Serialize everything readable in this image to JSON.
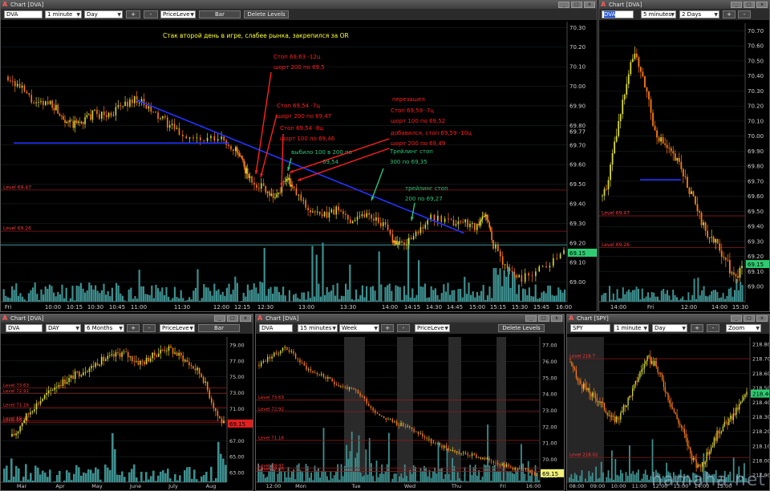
{
  "colors": {
    "red_line": "#8b1a1a",
    "teal_line": "#3a9a9a",
    "blue_trend": "#2233ff",
    "annotation_red": "#ff2020",
    "annotation_green": "#2ec47a",
    "annotation_yellow": "#ffff33",
    "candle_up": "#d8d838",
    "candle_down": "#ff7a1a",
    "volume": "#3e8f8f",
    "price_tag_green": "#2ecc71"
  },
  "watermark": "hamaha.net",
  "windows": {
    "main": {
      "title": "Chart [DVA]",
      "symbol": "DVA",
      "interval": "1 minute",
      "period": "Day",
      "indicator": "PriceLeve",
      "type_button": "Bar",
      "delete_button": "Delete Levels",
      "price_tag": "69.15",
      "last_tag": "69.77"
    },
    "topright": {
      "title": "Chart [DVA]",
      "symbol": "DVA",
      "interval": "5 minutes",
      "period": "2 Days",
      "price_tag": "69.15"
    },
    "bl": {
      "title": "Chart [DVA]",
      "symbol": "DVA",
      "interval": "DAY",
      "period": "6 Months",
      "indicator": "PriceLeve",
      "type_button": "Bar",
      "price_tag": "69.15"
    },
    "bm": {
      "title": "Chart [DVA]",
      "symbol": "DVA",
      "interval": "15 minutes",
      "period": "Week",
      "indicator": "PriceLeve",
      "delete_button": "Delete Levels",
      "price_tag": "69.15"
    },
    "br": {
      "title": "Chart [SPY]",
      "symbol": "SPY",
      "interval": "1 minute",
      "period": "Day",
      "indicator": "Zoom",
      "price_tag": "218.46"
    }
  },
  "chart_data": [
    {
      "id": "main",
      "type": "candlestick",
      "symbol": "DVA",
      "interval": "1 minute",
      "y_ticks": [
        "70.30",
        "70.20",
        "70.10",
        "70.00",
        "69.90",
        "69.80",
        "69.70",
        "69.60",
        "69.50",
        "69.40",
        "69.30",
        "69.20",
        "69.10",
        "69.00"
      ],
      "x_ticks": [
        "Fri",
        "10:00",
        "10:15",
        "10:30",
        "10:45",
        "11:00",
        "11:30",
        "12:00",
        "12:15",
        "12:30",
        "13:00",
        "13:30",
        "14:00",
        "14:15",
        "14:30",
        "14:45",
        "15:00",
        "15:15",
        "15:30",
        "15:45",
        "16:00"
      ],
      "ylim": [
        68.9,
        70.33
      ],
      "time_range": [
        "09:30",
        "16:00"
      ],
      "series": [
        {
          "name": "price",
          "points": [
            [
              "09:30",
              70.05
            ],
            [
              "09:40",
              69.98
            ],
            [
              "09:50",
              69.9
            ],
            [
              "10:00",
              69.92
            ],
            [
              "10:08",
              69.85
            ],
            [
              "10:15",
              69.8
            ],
            [
              "10:22",
              69.82
            ],
            [
              "10:30",
              69.86
            ],
            [
              "10:40",
              69.85
            ],
            [
              "10:50",
              69.9
            ],
            [
              "11:00",
              69.94
            ],
            [
              "11:10",
              69.87
            ],
            [
              "11:20",
              69.82
            ],
            [
              "11:30",
              69.76
            ],
            [
              "11:45",
              69.72
            ],
            [
              "12:00",
              69.73
            ],
            [
              "12:10",
              69.67
            ],
            [
              "12:15",
              69.6
            ],
            [
              "12:20",
              69.52
            ],
            [
              "12:30",
              69.48
            ],
            [
              "12:38",
              69.43
            ],
            [
              "12:45",
              69.54
            ],
            [
              "12:50",
              69.47
            ],
            [
              "13:00",
              69.38
            ],
            [
              "13:10",
              69.33
            ],
            [
              "13:20",
              69.37
            ],
            [
              "13:30",
              69.32
            ],
            [
              "13:40",
              69.35
            ],
            [
              "13:50",
              69.32
            ],
            [
              "14:00",
              69.22
            ],
            [
              "14:05",
              69.19
            ],
            [
              "14:15",
              69.23
            ],
            [
              "14:25",
              69.33
            ],
            [
              "14:40",
              69.3
            ],
            [
              "14:50",
              69.31
            ],
            [
              "15:00",
              69.28
            ],
            [
              "15:05",
              69.36
            ],
            [
              "15:10",
              69.2
            ],
            [
              "15:20",
              69.07
            ],
            [
              "15:30",
              69.02
            ],
            [
              "15:45",
              69.08
            ],
            [
              "16:00",
              69.15
            ]
          ]
        }
      ],
      "levels": [
        {
          "label": "Level 69.47",
          "value": 69.47,
          "color": "red"
        },
        {
          "label": "Level 69.26",
          "value": 69.26,
          "color": "red"
        },
        {
          "label": "",
          "value": 69.19,
          "color": "teal"
        }
      ],
      "trendlines": [
        {
          "from": [
            "09:34",
            69.71
          ],
          "to": [
            "12:05",
            69.71
          ]
        },
        {
          "from": [
            "11:00",
            69.93
          ],
          "to": [
            "14:50",
            69.25
          ]
        }
      ],
      "annotations": [
        {
          "text": "Стак второй день в игре, слабее рынка, закрепился за OR",
          "color": "yellow"
        },
        {
          "text": "Стоп 69,63 -12ц",
          "color": "red"
        },
        {
          "text": "шорт 200 по 69,5",
          "color": "red"
        },
        {
          "text": "Стоп 69,54 -7ц",
          "color": "red"
        },
        {
          "text": "шорт 200 по 69,47",
          "color": "red"
        },
        {
          "text": "Стоп 69,54 -8ц",
          "color": "red"
        },
        {
          "text": "шорт 100 по 69,46",
          "color": "red"
        },
        {
          "text": "выбило 100 в 200 по",
          "color": "green"
        },
        {
          "text": "69,54",
          "color": "green"
        },
        {
          "text": "перезашел",
          "color": "red"
        },
        {
          "text": "Стоп 69,59 -7ц",
          "color": "red"
        },
        {
          "text": "шорт 100 по 69,52",
          "color": "red"
        },
        {
          "text": "добавился, стоп 69,59 -10ц",
          "color": "red"
        },
        {
          "text": "шорт 200 по 69,49",
          "color": "red"
        },
        {
          "text": "Трейлинг стоп",
          "color": "green"
        },
        {
          "text": "300 по 69,35",
          "color": "green"
        },
        {
          "text": "трейлинг стоп",
          "color": "green"
        },
        {
          "text": "200 по 69,27",
          "color": "green"
        }
      ]
    },
    {
      "id": "topright",
      "type": "candlestick",
      "symbol": "DVA",
      "interval": "5 minutes",
      "y_ticks": [
        "70.70",
        "70.60",
        "70.50",
        "70.40",
        "70.30",
        "70.20",
        "70.10",
        "70.00",
        "69.90",
        "69.80",
        "69.70",
        "69.60",
        "69.50",
        "69.40",
        "69.30",
        "69.20",
        "69.10",
        "69.00"
      ],
      "x_ticks": [
        "14:00",
        "Fri",
        "12:00",
        "14:00",
        "15:30"
      ],
      "ylim": [
        68.9,
        70.75
      ],
      "series": [
        {
          "name": "price",
          "values": [
            69.6,
            69.7,
            69.9,
            70.1,
            70.3,
            70.5,
            70.55,
            70.4,
            70.3,
            70.1,
            70.0,
            69.95,
            69.9,
            69.85,
            69.8,
            69.7,
            69.6,
            69.5,
            69.4,
            69.35,
            69.3,
            69.25,
            69.2,
            69.1,
            69.05,
            69.15
          ]
        }
      ],
      "levels": [
        {
          "label": "Level 69.47",
          "value": 69.47
        },
        {
          "label": "Level 69.26",
          "value": 69.26
        }
      ],
      "trendlines": [
        {
          "from": [
            0.28,
            69.71
          ],
          "to": [
            0.56,
            69.71
          ]
        }
      ]
    },
    {
      "id": "bl",
      "type": "candlestick",
      "symbol": "DVA",
      "interval": "DAY",
      "y_ticks": [
        "79.00",
        "77.00",
        "75.00",
        "73.00",
        "71.00",
        "69.00",
        "67.00",
        "65.00",
        "63.00"
      ],
      "x_ticks": [
        "Mar",
        "Apr",
        "May",
        "June",
        "July",
        "Aug"
      ],
      "ylim": [
        61.8,
        80
      ],
      "series": [
        {
          "name": "price",
          "values": [
            67.5,
            68.2,
            69.5,
            70.3,
            71.2,
            71.8,
            72.5,
            73.0,
            73.8,
            74.2,
            74.5,
            74.8,
            75.3,
            75.6,
            76.0,
            76.2,
            76.8,
            77.1,
            77.3,
            77.5,
            77.9,
            78.0,
            77.6,
            77.2,
            76.8,
            76.9,
            77.4,
            77.8,
            78.2,
            78.6,
            78.4,
            77.9,
            77.5,
            76.9,
            76.3,
            75.8,
            75.0,
            73.2,
            71.5,
            69.9,
            69.15
          ]
        }
      ],
      "levels": [
        {
          "label": "Level 73.63",
          "value": 73.63
        },
        {
          "label": "Level 72.92",
          "value": 72.92
        },
        {
          "label": "Level 71.16",
          "value": 71.16
        },
        {
          "label": "Level 69.47",
          "value": 69.47
        },
        {
          "label": "Level 69.26",
          "value": 69.26
        }
      ]
    },
    {
      "id": "bm",
      "type": "candlestick",
      "symbol": "DVA",
      "interval": "15 minutes",
      "y_ticks": [
        "77.00",
        "76.00",
        "75.00",
        "74.00",
        "73.00",
        "72.00",
        "71.00",
        "70.00",
        "69.00"
      ],
      "x_ticks": [
        "12:00",
        "Mon",
        "Tue",
        "Wed",
        "Thu",
        "Fri",
        "16:00"
      ],
      "ylim": [
        68.6,
        77.5
      ],
      "series": [
        {
          "name": "price",
          "values": [
            75.8,
            76.2,
            76.5,
            76.9,
            76.4,
            75.8,
            75.4,
            75.2,
            74.9,
            74.6,
            74.4,
            74.2,
            73.8,
            73.1,
            72.7,
            72.4,
            72.2,
            72.0,
            71.7,
            71.4,
            71.0,
            70.8,
            70.6,
            70.4,
            70.3,
            70.2,
            70.0,
            69.9,
            69.7,
            69.5,
            69.4,
            69.3,
            69.15
          ]
        }
      ],
      "levels": [
        {
          "label": "Level 73.63",
          "value": 73.63
        },
        {
          "label": "Level 72.92",
          "value": 72.92
        },
        {
          "label": "Level 71.16",
          "value": 71.16
        },
        {
          "label": "Level 69.47",
          "value": 69.47
        },
        {
          "label": "Level 69.26",
          "value": 69.26
        }
      ]
    },
    {
      "id": "br",
      "type": "candlestick",
      "symbol": "SPY",
      "interval": "1 minute",
      "y_ticks": [
        "218.80",
        "218.70",
        "218.60",
        "218.50",
        "218.40",
        "218.30",
        "218.20",
        "218.10",
        "218.00",
        "217.90"
      ],
      "x_ticks": [
        "08:00",
        "09:00",
        "10:00",
        "11:00",
        "12:00",
        "13:00",
        "14:00",
        "15:00"
      ],
      "ylim": [
        217.85,
        218.85
      ],
      "series": [
        {
          "name": "price",
          "values": [
            218.68,
            218.55,
            218.5,
            218.45,
            218.42,
            218.35,
            218.28,
            218.3,
            218.4,
            218.5,
            218.62,
            218.7,
            218.66,
            218.55,
            218.42,
            218.3,
            218.2,
            218.05,
            217.95,
            218.0,
            218.1,
            218.2,
            218.25,
            218.3,
            218.38,
            218.46
          ]
        }
      ],
      "levels": [
        {
          "label": "Level 218.7",
          "value": 218.7
        },
        {
          "label": "Level 218.02",
          "value": 218.02
        }
      ]
    }
  ]
}
